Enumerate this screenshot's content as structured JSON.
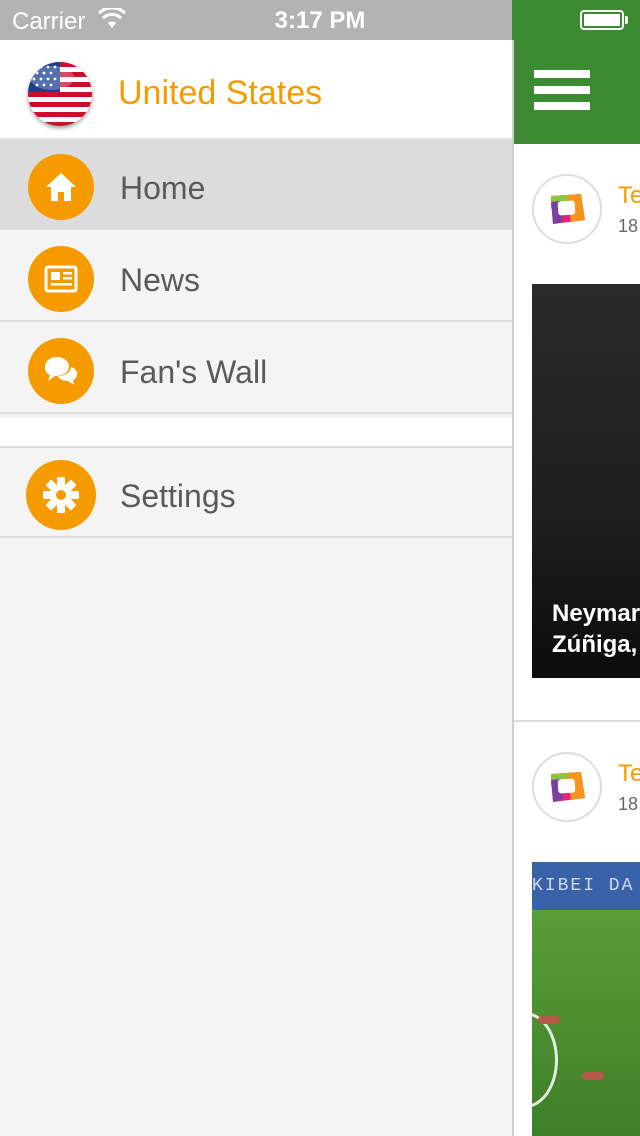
{
  "status_bar": {
    "carrier": "Carrier",
    "time": "3:17 PM"
  },
  "drawer": {
    "country": "United States",
    "accent_color": "#f59b00",
    "items": [
      {
        "label": "Home",
        "icon": "home-icon",
        "active": true
      },
      {
        "label": "News",
        "icon": "newspaper-icon",
        "active": false
      },
      {
        "label": "Fan's Wall",
        "icon": "chat-bubbles-icon",
        "active": false
      }
    ],
    "settings": {
      "label": "Settings",
      "icon": "gear-icon"
    }
  },
  "main": {
    "nav_color": "#3c8a31",
    "cards": [
      {
        "source": "Te",
        "date": "18",
        "caption_line1": "Neymar",
        "caption_line2": "Zúñiga,"
      },
      {
        "source": "Te",
        "date": "18",
        "banner_text": "KIBEI DA"
      }
    ]
  }
}
